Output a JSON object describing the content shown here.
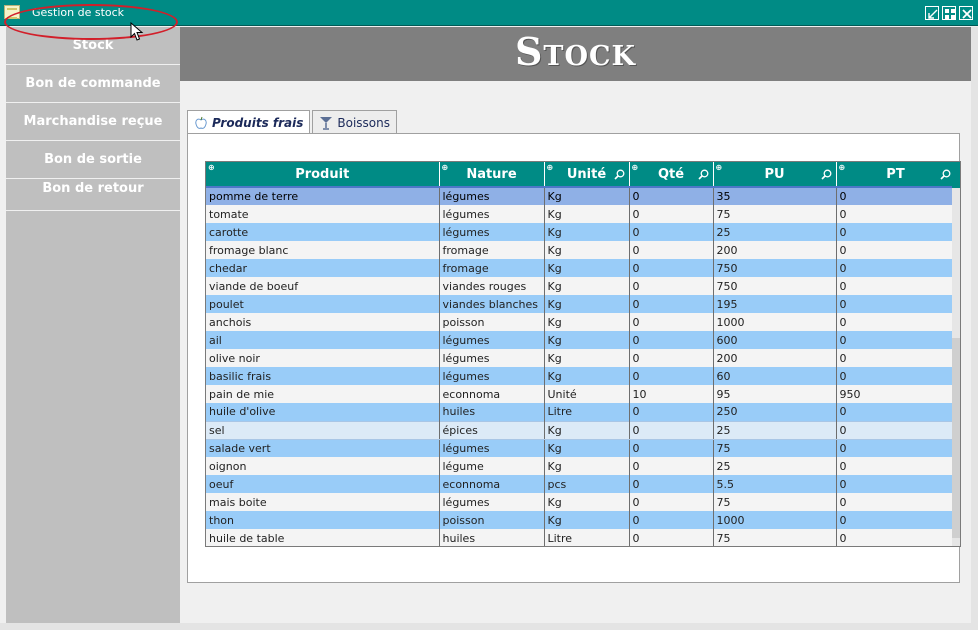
{
  "window": {
    "title": "Gestion de stock"
  },
  "sidebar": {
    "items": [
      {
        "label": "Stock"
      },
      {
        "label": "Bon de commande"
      },
      {
        "label": "Marchandise reçue"
      },
      {
        "label": "Bon de sortie"
      },
      {
        "label": "Bon de retour"
      }
    ]
  },
  "header": {
    "title": "Stock"
  },
  "tabs": [
    {
      "label": "Produits frais",
      "active": true
    },
    {
      "label": "Boissons",
      "active": false
    }
  ],
  "table": {
    "columns": [
      "Produit",
      "Nature",
      "Unité",
      "Qté",
      "PU",
      "PT"
    ],
    "rows": [
      [
        "pomme de terre",
        "légumes",
        "Kg",
        "0",
        "35",
        "0"
      ],
      [
        "tomate",
        "légumes",
        "Kg",
        "0",
        "75",
        "0"
      ],
      [
        "carotte",
        "légumes",
        "Kg",
        "0",
        "25",
        "0"
      ],
      [
        "fromage blanc",
        "fromage",
        "Kg",
        "0",
        "200",
        "0"
      ],
      [
        "chedar",
        "fromage",
        "Kg",
        "0",
        "750",
        "0"
      ],
      [
        "viande de boeuf",
        "viandes rouges",
        "Kg",
        "0",
        "750",
        "0"
      ],
      [
        "poulet",
        "viandes blanches",
        "Kg",
        "0",
        "195",
        "0"
      ],
      [
        "anchois",
        "poisson",
        "Kg",
        "0",
        "1000",
        "0"
      ],
      [
        "ail",
        "légumes",
        "Kg",
        "0",
        "600",
        "0"
      ],
      [
        "olive noir",
        "légumes",
        "Kg",
        "0",
        "200",
        "0"
      ],
      [
        "basilic frais",
        "légumes",
        "Kg",
        "0",
        "60",
        "0"
      ],
      [
        "pain de mie",
        "econnoma",
        "Unité",
        "10",
        "95",
        "950"
      ],
      [
        "huile d'olive",
        "huiles",
        "Litre",
        "0",
        "250",
        "0"
      ],
      [
        "sel",
        "épices",
        "Kg",
        "0",
        "25",
        "0"
      ],
      [
        "salade vert",
        "légumes",
        "Kg",
        "0",
        "75",
        "0"
      ],
      [
        "oignon",
        "légume",
        "Kg",
        "0",
        "25",
        "0"
      ],
      [
        "oeuf",
        "econnoma",
        "pcs",
        "0",
        "5.5",
        "0"
      ],
      [
        "mais boite",
        "légumes",
        "Kg",
        "0",
        "75",
        "0"
      ],
      [
        "thon",
        "poisson",
        "Kg",
        "0",
        "1000",
        "0"
      ],
      [
        "huile de table",
        "huiles",
        "Litre",
        "0",
        "75",
        "0"
      ]
    ]
  },
  "colors": {
    "accent": "#008b85",
    "row_alt": "#99ccf8",
    "sidebar": "#bfbfbf",
    "header": "#7f7f7f",
    "highlight_circle": "#d21f2a"
  }
}
